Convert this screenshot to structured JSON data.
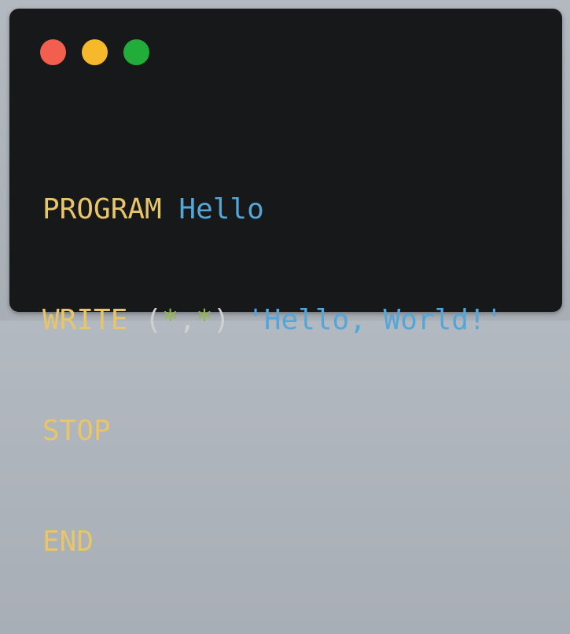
{
  "window": {
    "controls": [
      {
        "name": "close",
        "color": "#f25f4f"
      },
      {
        "name": "minimize",
        "color": "#f5b92b"
      },
      {
        "name": "maximize",
        "color": "#22ad3a"
      }
    ]
  },
  "colors": {
    "background": "#171819",
    "keyword": "#e8c568",
    "identifier": "#54a6d8",
    "string": "#54a6d8",
    "star": "#94b84a",
    "punctuation": "#cfcfcf"
  },
  "code": {
    "line1": {
      "kw": "PROGRAM",
      "ident": "Hello"
    },
    "line2": {
      "kw": "WRITE",
      "open": "(",
      "star1": "*",
      "comma": ",",
      "star2": "*",
      "close": ")",
      "str": "'Hello, World!'"
    },
    "line3": {
      "kw": "STOP"
    },
    "line4": {
      "kw": "END"
    }
  }
}
